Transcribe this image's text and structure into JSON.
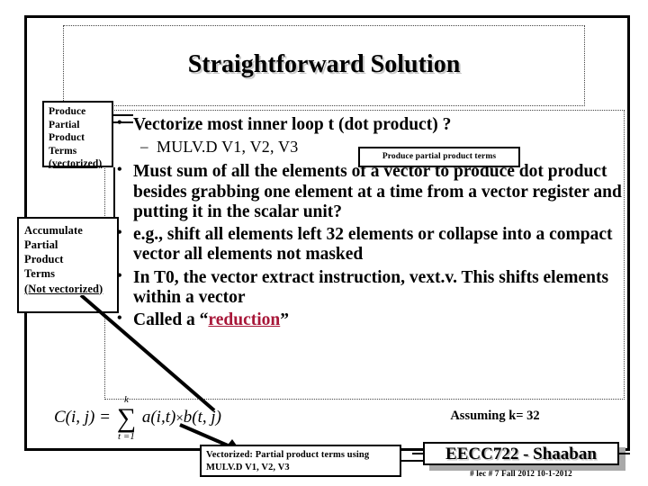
{
  "slide": {
    "title": "Straightforward Solution",
    "bullets": [
      {
        "text": "Vectorize most inner loop t (dot product) ?",
        "marker": "•"
      },
      {
        "text": "Must sum of all the elements of a vector to produce dot product besides grabbing one element at a time from a vector register and putting it in the scalar unit?",
        "marker": "•"
      },
      {
        "text": "e.g., shift all elements left 32 elements or collapse into a compact vector all elements not masked",
        "marker": "•"
      },
      {
        "text": "In T0, the vector extract instruction, vext.v.  This shifts elements within a vector",
        "marker": "•"
      }
    ],
    "sub_bullet": {
      "marker": "–",
      "text": "MULV.D V1, V2, V3"
    },
    "last_bullet": {
      "marker": "•",
      "prefix": "Called a “",
      "link": "reduction",
      "suffix": "”"
    }
  },
  "callouts": {
    "produce_partial_inline": "Produce partial product terms",
    "produce_box": {
      "line1": "Produce",
      "line2": "Partial",
      "line3": "Product",
      "line4": "Terms",
      "line5": "(vectorized)"
    },
    "accumulate_box": {
      "line1": "Accumulate",
      "line2": "Partial",
      "line3": "Product",
      "line4": "Terms",
      "line5": "(Not vectorized)"
    },
    "bottom_box": {
      "line1": "Vectorized: Partial product terms using",
      "line2": "MULV.D V1, V2, V3"
    }
  },
  "formula": {
    "lhs": "C(i, j) =",
    "sigma": "∑",
    "sigma_top": "k",
    "sigma_bottom": "t =1",
    "term_a": "a(i,t)",
    "times": "×",
    "term_b": "b(t, j)"
  },
  "notes": {
    "assuming": "Assuming k= 32"
  },
  "footer": {
    "brand": "EECC722 - Shaaban",
    "sub": "#  lec # 7    Fall 2012   10-1-2012"
  },
  "colors": {
    "accent_link": "#a81739",
    "frame": "#000000",
    "shadow": "#a9a9a9"
  }
}
